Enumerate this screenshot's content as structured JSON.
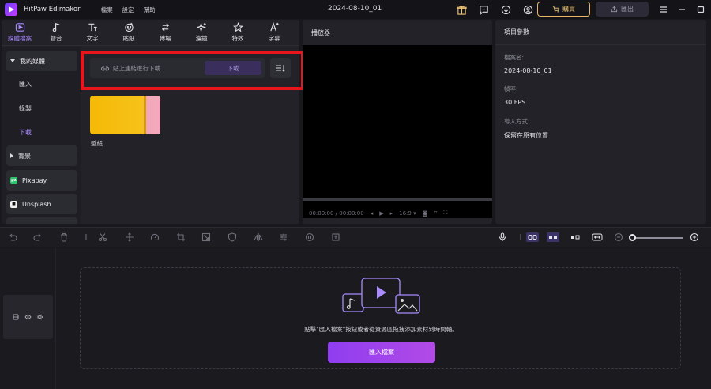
{
  "app": {
    "name": "HitPaw Edimakor",
    "doc_title": "2024-08-10_01"
  },
  "menu": [
    "檔案",
    "設定",
    "幫助"
  ],
  "titlebar": {
    "buy_label": "購買",
    "export_label": "匯出"
  },
  "category_tabs": [
    {
      "label": "媒體檔案",
      "icon": "media-icon",
      "active": true
    },
    {
      "label": "聲音",
      "icon": "music-note-icon"
    },
    {
      "label": "文字",
      "icon": "text-icon"
    },
    {
      "label": "貼紙",
      "icon": "sticker-icon"
    },
    {
      "label": "轉場",
      "icon": "transition-icon"
    },
    {
      "label": "濾鏡",
      "icon": "filter-sparkle-icon"
    },
    {
      "label": "特效",
      "icon": "effects-icon"
    },
    {
      "label": "字幕",
      "icon": "subtitle-icon"
    }
  ],
  "sidebar": {
    "my_media": "我的媒體",
    "items": [
      "匯入",
      "錄製",
      "下載"
    ],
    "active_item": "下載",
    "background": "背景",
    "pixabay": "Pixabay",
    "unsplash": "Unsplash"
  },
  "download": {
    "placeholder": "貼上連結進行下載",
    "button": "下載"
  },
  "media_items": [
    {
      "label": "壁紙"
    }
  ],
  "player": {
    "title": "播放器",
    "time": "00:00:00 / 00:00:00",
    "aspect": "16:9"
  },
  "properties": {
    "title": "項目參數",
    "fields": [
      {
        "label": "檔案名:",
        "value": "2024-08-10_01"
      },
      {
        "label": "幀率:",
        "value": "30 FPS"
      },
      {
        "label": "導入方式:",
        "value": "保留在原有位置"
      }
    ]
  },
  "timeline": {
    "hint": "點擊\"匯入檔案\"按鈕或者從資源區拖拽添加素材到時間軸。",
    "import_button": "匯入檔案"
  },
  "colors": {
    "accent": "#a98bff",
    "highlight_outline": "#e8161c",
    "import_button": "#9b44ec",
    "buy_border": "#e8b96a"
  }
}
